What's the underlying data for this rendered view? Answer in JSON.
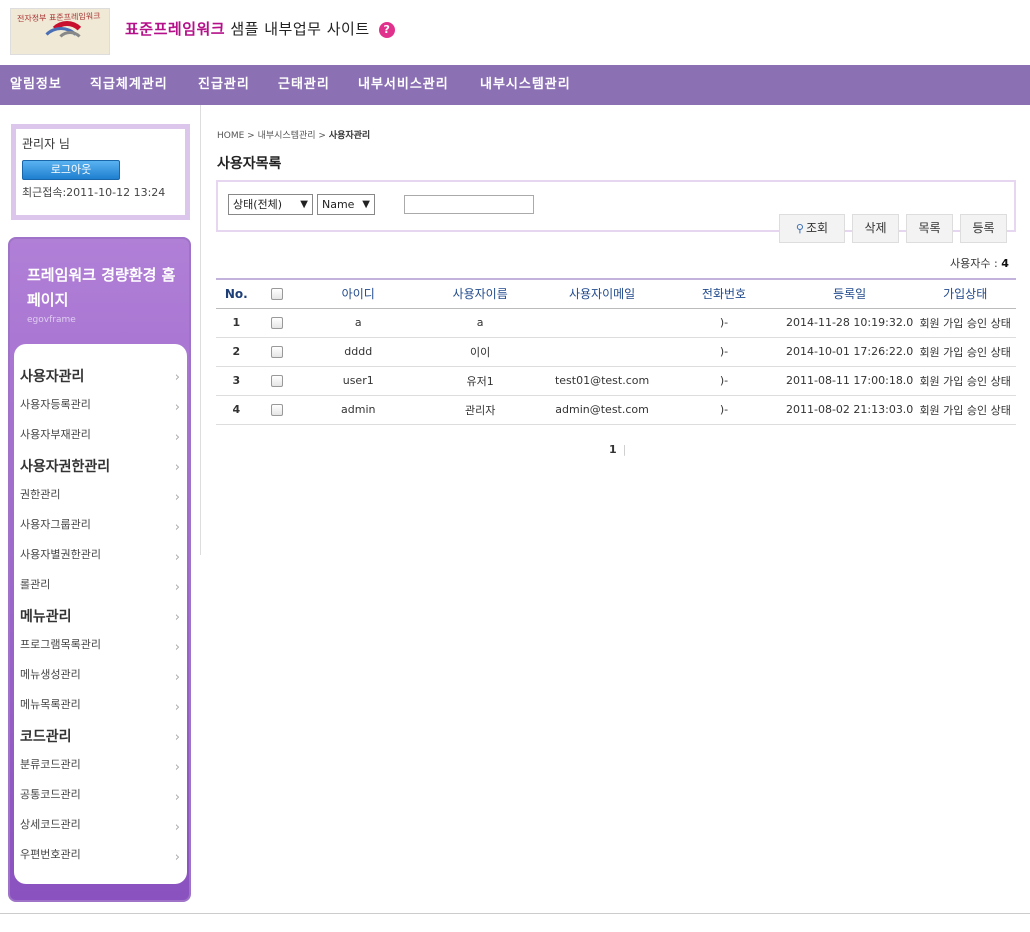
{
  "header": {
    "logo_text": "전자정부 표준프레임워크",
    "title_accent": "표준프레임워크",
    "title_rest": " 샘플 내부업무 사이트",
    "help_icon": "?"
  },
  "gnb": [
    "알림정보",
    "직급체계관리",
    "진급관리",
    "근태관리",
    "내부서비스관리",
    "내부시스템관리"
  ],
  "login": {
    "user": "관리자 님",
    "logout_label": "로그아웃",
    "last_login": "최근접속:2011-10-12 13:24"
  },
  "lnb": {
    "title": "프레임워크 경량환경 홈페이지",
    "subtitle": "egovframe",
    "rows": [
      {
        "type": "head",
        "label": "사용자관리"
      },
      {
        "type": "item",
        "label": "사용자등록관리"
      },
      {
        "type": "item",
        "label": "사용자부재관리"
      },
      {
        "type": "head",
        "label": "사용자권한관리"
      },
      {
        "type": "item",
        "label": "권한관리"
      },
      {
        "type": "item",
        "label": "사용자그룹관리"
      },
      {
        "type": "item",
        "label": "사용자별권한관리"
      },
      {
        "type": "item",
        "label": "롤관리"
      },
      {
        "type": "head",
        "label": "메뉴관리"
      },
      {
        "type": "item",
        "label": "프로그램목록관리"
      },
      {
        "type": "item",
        "label": "메뉴생성관리"
      },
      {
        "type": "item",
        "label": "메뉴목록관리"
      },
      {
        "type": "head",
        "label": "코드관리"
      },
      {
        "type": "item",
        "label": "분류코드관리"
      },
      {
        "type": "item",
        "label": "공통코드관리"
      },
      {
        "type": "item",
        "label": "상세코드관리"
      },
      {
        "type": "item",
        "label": "우편번호관리"
      }
    ],
    "arrow": "›"
  },
  "breadcrumb": {
    "home": "HOME",
    "sep1": " > ",
    "section": "내부시스템관리",
    "sep2": " > ",
    "current": "사용자관리"
  },
  "page_title": "사용자목록",
  "search": {
    "status_select": "상태(전체)",
    "field_select": "Name",
    "caret": "▼",
    "input_value": ""
  },
  "buttons": {
    "search": "조회",
    "delete": "삭제",
    "list": "목록",
    "register": "등록",
    "search_icon": "⚲"
  },
  "user_count": {
    "label": "사용자수 : ",
    "value": "4"
  },
  "table": {
    "headers": [
      "No.",
      "",
      "아이디",
      "사용자이름",
      "사용자이메일",
      "전화번호",
      "등록일",
      "가입상태"
    ],
    "rows": [
      {
        "no": "1",
        "id": "a",
        "name": "a",
        "email": "",
        "phone": ")-",
        "date": "2014-11-28 10:19:32.0",
        "status": "회원 가입 승인 상태"
      },
      {
        "no": "2",
        "id": "dddd",
        "name": "이이",
        "email": "",
        "phone": ")-",
        "date": "2014-10-01 17:26:22.0",
        "status": "회원 가입 승인 상태"
      },
      {
        "no": "3",
        "id": "user1",
        "name": "유저1",
        "email": "test01@test.com",
        "phone": ")-",
        "date": "2011-08-11 17:00:18.0",
        "status": "회원 가입 승인 상태"
      },
      {
        "no": "4",
        "id": "admin",
        "name": "관리자",
        "email": "admin@test.com",
        "phone": ")-",
        "date": "2011-08-02 21:13:03.0",
        "status": "회원 가입 승인 상태"
      }
    ]
  },
  "paging": {
    "current": "1",
    "sep": "|"
  },
  "colors": {
    "nav_bg": "#8b70b4",
    "accent": "#b5108a",
    "lnb_bg": "#9e6cc8"
  }
}
